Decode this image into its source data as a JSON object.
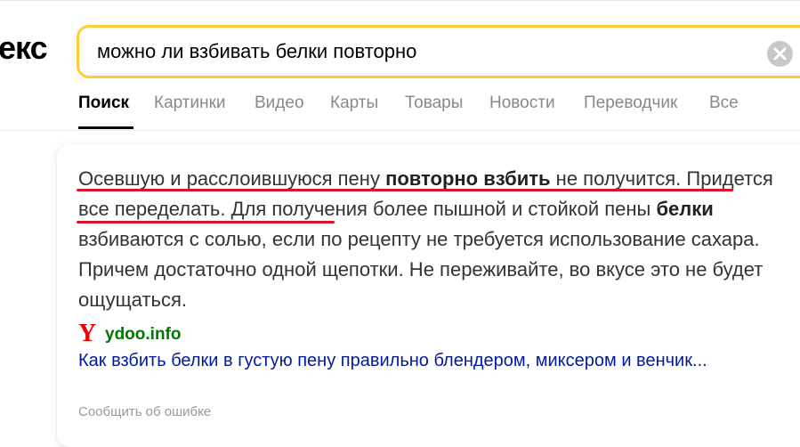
{
  "logo": {
    "text": "екс"
  },
  "search": {
    "query": "можно ли взбивать белки повторно"
  },
  "tabs": [
    "Поиск",
    "Картинки",
    "Видео",
    "Карты",
    "Товары",
    "Новости",
    "Переводчик",
    "Все"
  ],
  "snippet": {
    "p1": "Осевшую и расслоившуюся пену ",
    "b1": "повторно взбить",
    "p2": " не получится. Придется все переделать. Для получения более пышной и стойкой пены ",
    "b2": "белки",
    "p3": " взбиваются с солью, если по рецепту не требуется использование сахара. Причем достаточно одной щепотки. Не переживайте, во вкусе это не будет ощущаться."
  },
  "source": {
    "icon": "yandex-y-icon",
    "icon_glyph": "Y",
    "domain": "ydoo.info"
  },
  "result": {
    "title": "Как взбить белки в густую пену правильно блендером, миксером и венчик..."
  },
  "footer": {
    "report": "Сообщить об ошибке"
  },
  "colors": {
    "accent": "#ffcc33",
    "link": "#001a9e",
    "domain": "#007700",
    "annotation": "#d4162a"
  }
}
